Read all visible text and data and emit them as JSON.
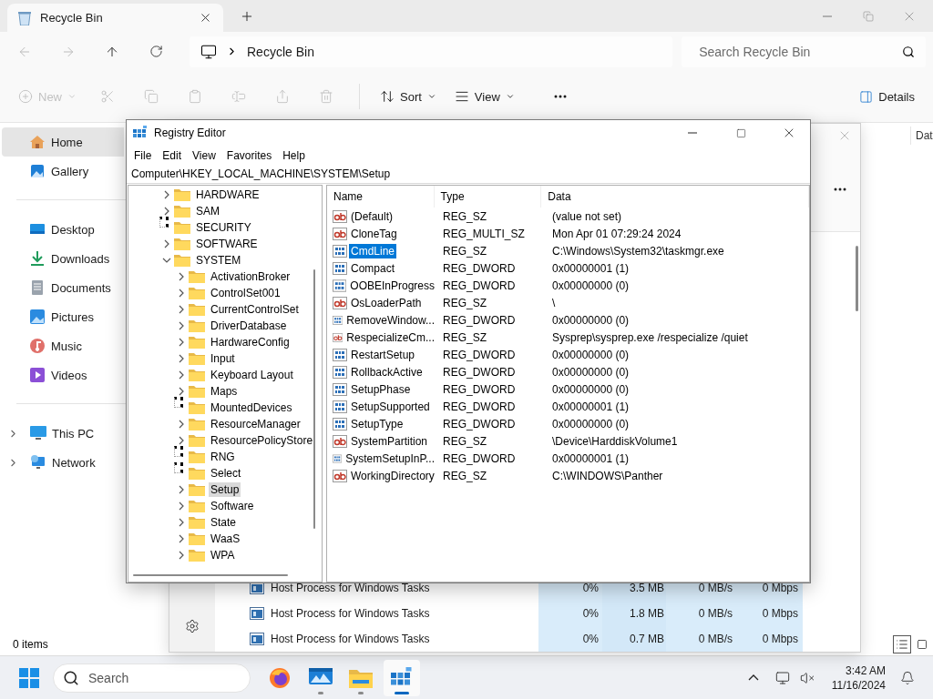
{
  "explorer": {
    "tab": {
      "title": "Recycle Bin"
    },
    "address": {
      "crumbs": [
        "Recycle Bin"
      ]
    },
    "search": {
      "placeholder": "Search Recycle Bin"
    },
    "command_bar": [
      {
        "kind": "new",
        "label": "New",
        "disabled": true,
        "menu": true
      },
      {
        "kind": "cut",
        "disabled": true,
        "menu": false
      },
      {
        "kind": "copy",
        "disabled": true,
        "menu": false
      },
      {
        "kind": "paste",
        "disabled": true,
        "menu": false
      },
      {
        "kind": "rename",
        "disabled": true,
        "menu": false
      },
      {
        "kind": "share",
        "disabled": true,
        "menu": false
      },
      {
        "kind": "delete",
        "disabled": true,
        "menu": false
      },
      {
        "kind": "sort",
        "label": "Sort",
        "disabled": false,
        "menu": true
      },
      {
        "kind": "view",
        "label": "View",
        "disabled": false,
        "menu": true
      },
      {
        "kind": "more",
        "disabled": false,
        "menu": false
      }
    ],
    "details_button": {
      "label": "Details"
    },
    "sidebar": {
      "groups": [
        {
          "items": [
            {
              "kind": "home",
              "label": "Home",
              "selected": true,
              "expandable": false
            },
            {
              "kind": "gallery",
              "label": "Gallery",
              "selected": false,
              "expandable": false
            }
          ]
        },
        {
          "items": [
            {
              "kind": "desktop",
              "label": "Desktop",
              "selected": false,
              "expandable": false
            },
            {
              "kind": "downloads",
              "label": "Downloads",
              "selected": false,
              "expandable": false
            },
            {
              "kind": "documents",
              "label": "Documents",
              "selected": false,
              "expandable": false
            },
            {
              "kind": "pictures",
              "label": "Pictures",
              "selected": false,
              "expandable": false
            },
            {
              "kind": "music",
              "label": "Music",
              "selected": false,
              "expandable": false
            },
            {
              "kind": "videos",
              "label": "Videos",
              "selected": false,
              "expandable": false
            }
          ]
        },
        {
          "items": [
            {
              "kind": "pc",
              "label": "This PC",
              "selected": false,
              "expandable": true
            },
            {
              "kind": "network",
              "label": "Network",
              "selected": false,
              "expandable": true
            }
          ]
        }
      ]
    },
    "column_header": "Dat",
    "status_bar": {
      "count": "0 items",
      "views": [
        {
          "kind": "details",
          "selected": true
        },
        {
          "kind": "tiles",
          "selected": false
        }
      ]
    }
  },
  "task_manager": {
    "processes": [
      {
        "name": "Host Process for Windows Tasks",
        "cpu": "0%",
        "memory": "3.5 MB",
        "disk": "0 MB/s",
        "network": "0 Mbps"
      },
      {
        "name": "Host Process for Windows Tasks",
        "cpu": "0%",
        "memory": "1.8 MB",
        "disk": "0 MB/s",
        "network": "0 Mbps"
      },
      {
        "name": "Host Process for Windows Tasks",
        "cpu": "0%",
        "memory": "0.7 MB",
        "disk": "0 MB/s",
        "network": "0 Mbps"
      }
    ]
  },
  "registry_editor": {
    "title": "Registry Editor",
    "menu": [
      "File",
      "Edit",
      "View",
      "Favorites",
      "Help"
    ],
    "path": "Computer\\HKEY_LOCAL_MACHINE\\SYSTEM\\Setup",
    "tree": [
      {
        "label": "HARDWARE",
        "expandable": true,
        "expanded": false,
        "selected": false
      },
      {
        "label": "SAM",
        "expandable": true,
        "expanded": false,
        "selected": false
      },
      {
        "label": "SECURITY",
        "expandable": false,
        "expanded": false,
        "selected": false
      },
      {
        "label": "SOFTWARE",
        "expandable": true,
        "expanded": false,
        "selected": false
      },
      {
        "label": "SYSTEM",
        "expandable": true,
        "expanded": true,
        "selected": false,
        "children": [
          {
            "label": "ActivationBroker",
            "expandable": true,
            "expanded": false,
            "selected": false
          },
          {
            "label": "ControlSet001",
            "expandable": true,
            "expanded": false,
            "selected": false
          },
          {
            "label": "CurrentControlSet",
            "expandable": true,
            "expanded": false,
            "selected": false
          },
          {
            "label": "DriverDatabase",
            "expandable": true,
            "expanded": false,
            "selected": false
          },
          {
            "label": "HardwareConfig",
            "expandable": true,
            "expanded": false,
            "selected": false
          },
          {
            "label": "Input",
            "expandable": true,
            "expanded": false,
            "selected": false
          },
          {
            "label": "Keyboard Layout",
            "expandable": true,
            "expanded": false,
            "selected": false
          },
          {
            "label": "Maps",
            "expandable": true,
            "expanded": false,
            "selected": false
          },
          {
            "label": "MountedDevices",
            "expandable": false,
            "expanded": false,
            "selected": false
          },
          {
            "label": "ResourceManager",
            "expandable": true,
            "expanded": false,
            "selected": false
          },
          {
            "label": "ResourcePolicyStore",
            "expandable": true,
            "expanded": false,
            "selected": false
          },
          {
            "label": "RNG",
            "expandable": false,
            "expanded": false,
            "selected": false
          },
          {
            "label": "Select",
            "expandable": false,
            "expanded": false,
            "selected": false
          },
          {
            "label": "Setup",
            "expandable": true,
            "expanded": false,
            "selected": true
          },
          {
            "label": "Software",
            "expandable": true,
            "expanded": false,
            "selected": false
          },
          {
            "label": "State",
            "expandable": true,
            "expanded": false,
            "selected": false
          },
          {
            "label": "WaaS",
            "expandable": true,
            "expanded": false,
            "selected": false
          },
          {
            "label": "WPA",
            "expandable": true,
            "expanded": false,
            "selected": false
          }
        ]
      }
    ],
    "columns": [
      "Name",
      "Type",
      "Data"
    ],
    "values": [
      {
        "kind": "string",
        "name": "(Default)",
        "type": "REG_SZ",
        "data": "(value not set)",
        "selected": false
      },
      {
        "kind": "string",
        "name": "CloneTag",
        "type": "REG_MULTI_SZ",
        "data": "Mon Apr 01 07:29:24 2024",
        "selected": false
      },
      {
        "kind": "binary",
        "name": "CmdLine",
        "type": "REG_SZ",
        "data": "C:\\Windows\\System32\\taskmgr.exe",
        "selected": true
      },
      {
        "kind": "binary",
        "name": "Compact",
        "type": "REG_DWORD",
        "data": "0x00000001 (1)",
        "selected": false
      },
      {
        "kind": "binary",
        "name": "OOBEInProgress",
        "type": "REG_DWORD",
        "data": "0x00000000 (0)",
        "selected": false
      },
      {
        "kind": "string",
        "name": "OsLoaderPath",
        "type": "REG_SZ",
        "data": "\\",
        "selected": false
      },
      {
        "kind": "binary",
        "name": "RemoveWindow...",
        "type": "REG_DWORD",
        "data": "0x00000000 (0)",
        "selected": false
      },
      {
        "kind": "string",
        "name": "RespecializeCm...",
        "type": "REG_SZ",
        "data": "Sysprep\\sysprep.exe /respecialize /quiet",
        "selected": false
      },
      {
        "kind": "binary",
        "name": "RestartSetup",
        "type": "REG_DWORD",
        "data": "0x00000000 (0)",
        "selected": false
      },
      {
        "kind": "binary",
        "name": "RollbackActive",
        "type": "REG_DWORD",
        "data": "0x00000000 (0)",
        "selected": false
      },
      {
        "kind": "binary",
        "name": "SetupPhase",
        "type": "REG_DWORD",
        "data": "0x00000000 (0)",
        "selected": false
      },
      {
        "kind": "binary",
        "name": "SetupSupported",
        "type": "REG_DWORD",
        "data": "0x00000001 (1)",
        "selected": false
      },
      {
        "kind": "binary",
        "name": "SetupType",
        "type": "REG_DWORD",
        "data": "0x00000000 (0)",
        "selected": false
      },
      {
        "kind": "string",
        "name": "SystemPartition",
        "type": "REG_SZ",
        "data": "\\Device\\HarddiskVolume1",
        "selected": false
      },
      {
        "kind": "binary",
        "name": "SystemSetupInP...",
        "type": "REG_DWORD",
        "data": "0x00000001 (1)",
        "selected": false
      },
      {
        "kind": "string",
        "name": "WorkingDirectory",
        "type": "REG_SZ",
        "data": "C:\\WINDOWS\\Panther",
        "selected": false
      }
    ]
  },
  "taskbar": {
    "search": {
      "placeholder": "Search"
    },
    "apps": [
      {
        "kind": "browser",
        "running": false,
        "active": false
      },
      {
        "kind": "monitor",
        "running": true,
        "active": false
      },
      {
        "kind": "files",
        "running": true,
        "active": false
      },
      {
        "kind": "registry",
        "running": true,
        "active": true
      }
    ],
    "clock": {
      "time": "3:42 AM",
      "date": "11/16/2024"
    }
  }
}
